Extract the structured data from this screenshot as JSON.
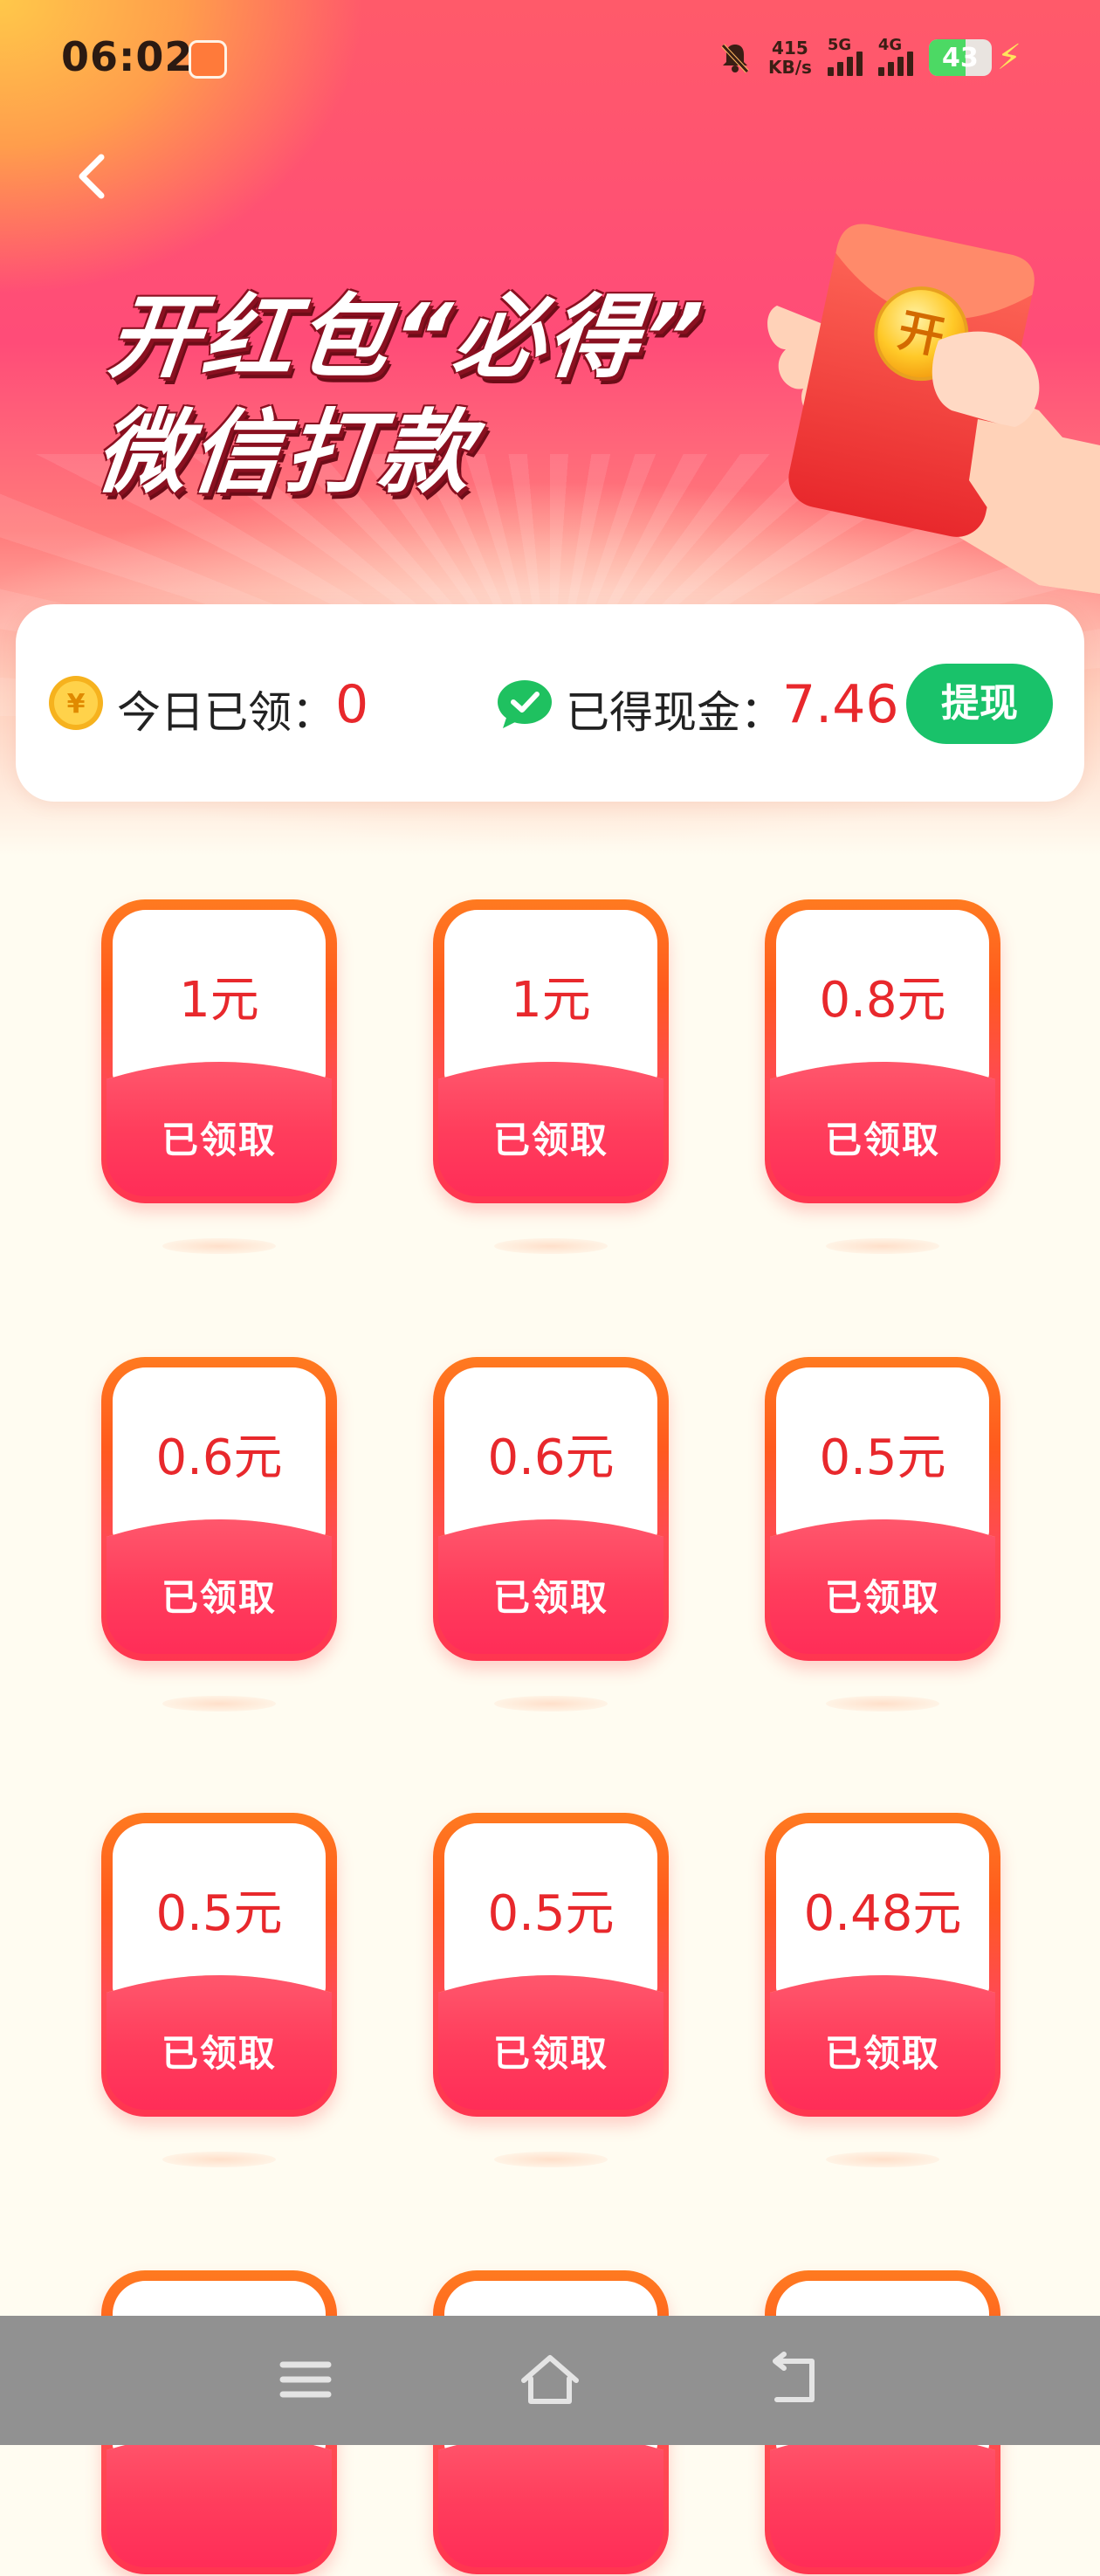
{
  "status_bar": {
    "time": "06:02",
    "net_speed_value": "415",
    "net_speed_unit": "KB/s",
    "signal_1": "5G",
    "signal_2": "4G",
    "battery": "43",
    "icons": [
      "app-notification-icon",
      "mute-bell-icon",
      "signal-icon",
      "battery-icon",
      "charging-bolt-icon"
    ]
  },
  "header": {
    "back_icon": "chevron-left-icon",
    "title_line1": "开红包“必得”",
    "title_line2": "微信打款"
  },
  "summary": {
    "today_label": "今日已领：",
    "today_value": "0",
    "cash_label": "已得现金：",
    "cash_value": "7.46",
    "withdraw_label": "提现",
    "coin_icon": "yuan-coin-icon",
    "wechat_icon": "wechat-icon"
  },
  "envelopes": [
    {
      "amount": "1元",
      "status": "已领取"
    },
    {
      "amount": "1元",
      "status": "已领取"
    },
    {
      "amount": "0.8元",
      "status": "已领取"
    },
    {
      "amount": "0.6元",
      "status": "已领取"
    },
    {
      "amount": "0.6元",
      "status": "已领取"
    },
    {
      "amount": "0.5元",
      "status": "已领取"
    },
    {
      "amount": "0.5元",
      "status": "已领取"
    },
    {
      "amount": "0.5元",
      "status": "已领取"
    },
    {
      "amount": "0.48元",
      "status": "已领取"
    }
  ],
  "nav_bar": {
    "icons": [
      "menu-icon",
      "home-icon",
      "back-icon"
    ]
  },
  "colors": {
    "accent_red": "#e8282c",
    "withdraw_green": "#19c26a",
    "hero_pink": "#ff4c78"
  }
}
